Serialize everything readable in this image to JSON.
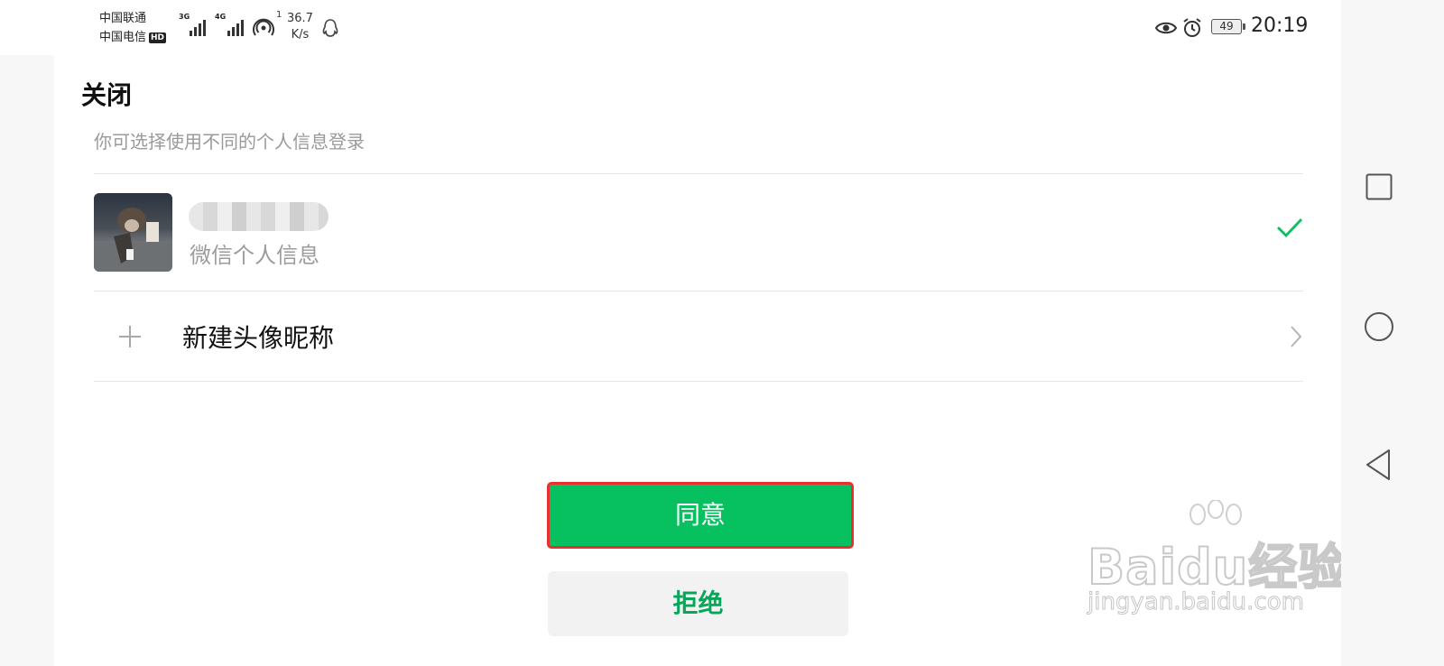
{
  "status_bar": {
    "carrier1": "中国联通",
    "carrier2": "中国电信",
    "hd_badge": "HD",
    "signal1_label": "3G",
    "signal2_label": "4G",
    "hotspot_count": "1",
    "net_speed": "36.7",
    "net_speed_unit": "K/s",
    "battery": "49",
    "time": "20:19"
  },
  "sheet": {
    "close_label": "关闭",
    "subtitle": "你可选择使用不同的个人信息登录",
    "account": {
      "subtitle": "微信个人信息",
      "selected": true
    },
    "new_profile_label": "新建头像昵称",
    "agree_label": "同意",
    "reject_label": "拒绝"
  },
  "watermark": {
    "brand": "Baidu经验",
    "url": "jingyan.baidu.com"
  },
  "colors": {
    "primary_green": "#07c160",
    "highlight_red": "#e8302e",
    "muted_text": "#9c9c9c"
  },
  "icons": [
    "eye-icon",
    "alarm-icon",
    "hotspot-icon",
    "qq-icon",
    "check-icon",
    "plus-icon",
    "chevron-right-icon",
    "square-nav-icon",
    "circle-nav-icon",
    "triangle-nav-icon"
  ]
}
